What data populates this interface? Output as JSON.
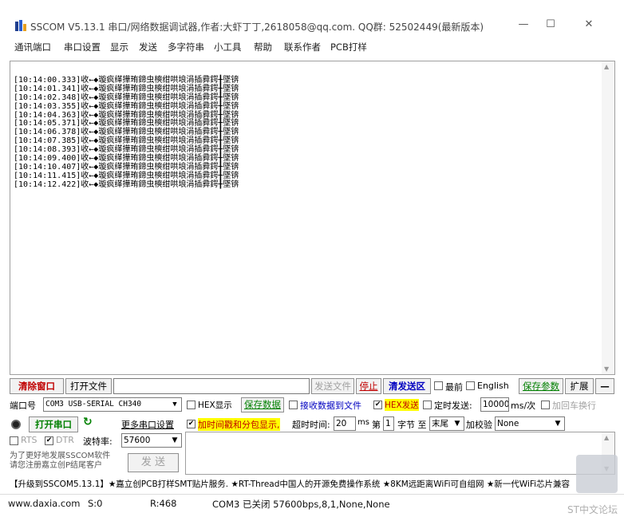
{
  "window": {
    "title": "SSCOM V5.13.1 串口/网络数据调试器,作者:大虾丁丁,2618058@qq.com. QQ群: 52502449(最新版本)",
    "minimize_glyph": "—",
    "maximize_glyph": "☐",
    "close_glyph": "✕",
    "app_icon": "sscom-app-icon"
  },
  "menu": [
    "通讯端口",
    "串口设置",
    "显示",
    "发送",
    "多字符串",
    "小工具",
    "帮助",
    "联系作者",
    "PCB打样"
  ],
  "receive": {
    "lines": [
      "[10:14:00.333]收←◆璇疯缂撶珛鍗虫樉绀哄埌涓插彛鍔╂墜锛",
      "[10:14:01.341]收←◆璇疯缂撶珛鍗虫樉绀哄埌涓插彛鍔╂墜锛",
      "[10:14:02.348]收←◆璇疯缂撶珛鍗虫樉绀哄埌涓插彛鍔╂墜锛",
      "[10:14:03.355]收←◆璇疯缂撶珛鍗虫樉绀哄埌涓插彛鍔╂墜锛",
      "[10:14:04.363]收←◆璇疯缂撶珛鍗虫樉绀哄埌涓插彛鍔╂墜锛",
      "[10:14:05.371]收←◆璇疯缂撶珛鍗虫樉绀哄埌涓插彛鍔╂墜锛",
      "[10:14:06.378]收←◆璇疯缂撶珛鍗虫樉绀哄埌涓插彛鍔╂墜锛",
      "[10:14:07.385]收←◆璇疯缂撶珛鍗虫樉绀哄埌涓插彛鍔╂墜锛",
      "[10:14:08.393]收←◆璇疯缂撶珛鍗虫樉绀哄埌涓插彛鍔╂墜锛",
      "[10:14:09.400]收←◆璇疯缂撶珛鍗虫樉绀哄埌涓插彛鍔╂墜锛",
      "[10:14:10.407]收←◆璇疯缂撶珛鍗虫樉绀哄埌涓插彛鍔╂墜锛",
      "[10:14:11.415]收←◆璇疯缂撶珛鍗虫樉绀哄埌涓插彛鍔╂墜锛",
      "[10:14:12.422]收←◆璇疯缂撶珛鍗虫樉绀哄埌涓插彛鍔╂墜锛"
    ]
  },
  "toolbar": {
    "clear_window": "清除窗口",
    "open_file": "打开文件",
    "send_file": "发送文件",
    "stop": "停止",
    "clear_send": "清发送区",
    "topmost": "最前",
    "english": "English",
    "save_params": "保存参数",
    "expand": "扩展",
    "collapse": "—"
  },
  "port": {
    "label": "端口号",
    "value": "COM3 USB-SERIAL CH340",
    "hex_display": "HEX显示",
    "save_data": "保存数据",
    "recv_to_file": "接收数据到文件",
    "hex_send": "HEX发送",
    "timed_send": "定时发送:",
    "interval": "10000",
    "interval_unit": "ms/次",
    "add_newline": "加回车换行",
    "open_port": "打开串口",
    "more_settings": "更多串口设置",
    "timestamp_split": "加时间戳和分包显示,",
    "timeout_label": "超时时间:",
    "timeout_value": "20",
    "timeout_unit": "ms",
    "page_label": "第",
    "page_value": "1",
    "byte_label": "字节 至",
    "end_value": "末尾",
    "checksum_label": "加校验",
    "checksum_value": "None",
    "rts": "RTS",
    "dtr": "DTR",
    "baud_label": "波特率:",
    "baud_value": "57600",
    "send_button": "发 送"
  },
  "promo": {
    "line1": "为了更好地发展SSCOM软件",
    "line2": "请您注册嘉立创P结尾客户",
    "ad": "【升级到SSCOM5.13.1】★嘉立创PCB打样SMT贴片服务. ★RT-Thread中国人的开源免费操作系统 ★8KM远距离WiFi可自组网 ★新一代WiFi芯片兼容"
  },
  "status": {
    "website": "www.daxia.com",
    "sent": "S:0",
    "received": "R:468",
    "port_state": "COM3 已关闭  57600bps,8,1,None,None",
    "watermark": "ST中文论坛"
  },
  "colors": {
    "accent_red": "#c00000",
    "link_green": "#008000",
    "highlight_yellow": "#ffff00"
  }
}
